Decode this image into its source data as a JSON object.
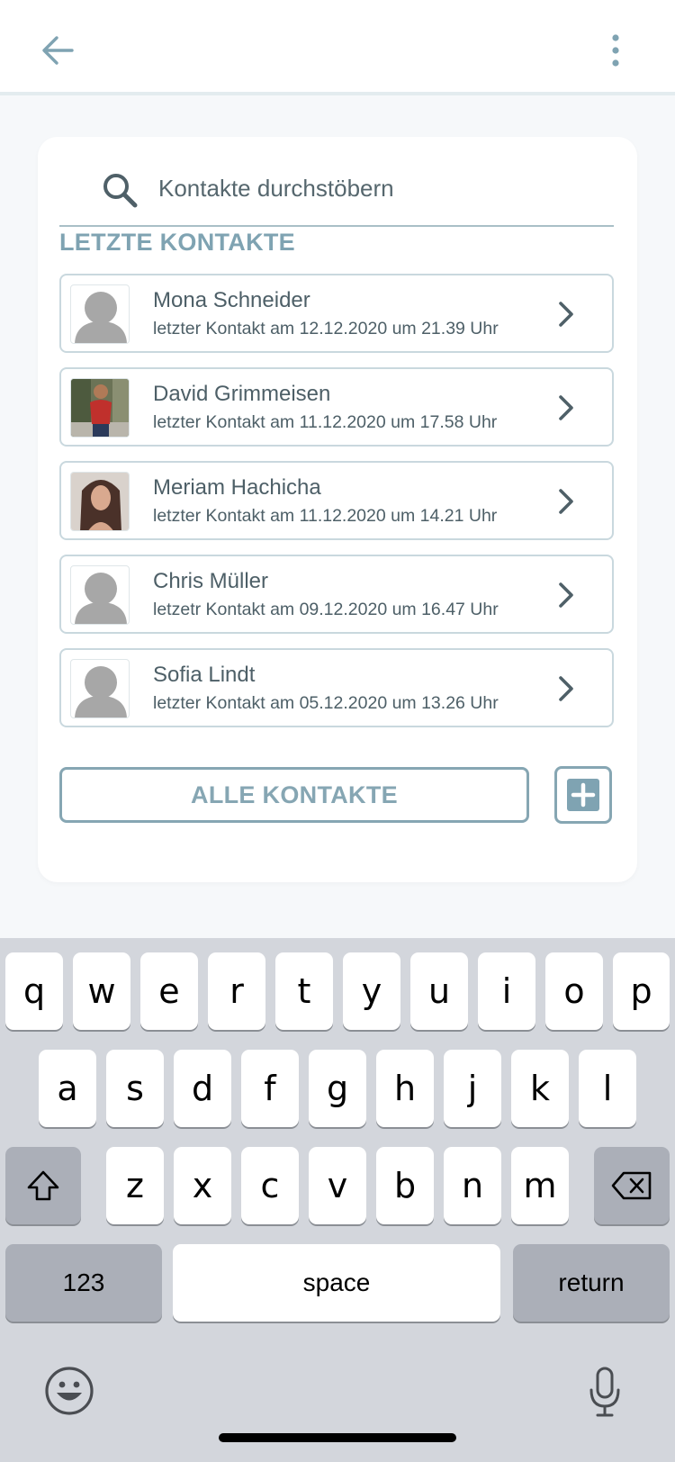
{
  "header": {
    "back_icon": "arrow-left-icon",
    "more_icon": "more-vertical-icon"
  },
  "search": {
    "placeholder": "Kontakte durchstöbern",
    "icon": "search-icon"
  },
  "section_title": "LETZTE KONTAKTE",
  "contacts": [
    {
      "name": "Mona Schneider",
      "last_contact": "letzter Kontakt am 12.12.2020 um 21.39 Uhr",
      "avatar": "placeholder"
    },
    {
      "name": "David Grimmeisen",
      "last_contact": "letzter Kontakt am 11.12.2020 um 17.58 Uhr",
      "avatar": "photo"
    },
    {
      "name": "Meriam Hachicha",
      "last_contact": "letzter Kontakt am 11.12.2020 um 14.21 Uhr",
      "avatar": "photo"
    },
    {
      "name": "Chris Müller",
      "last_contact": "letzetr Kontakt am 09.12.2020 um 16.47 Uhr",
      "avatar": "placeholder"
    },
    {
      "name": "Sofia Lindt",
      "last_contact": "letzter Kontakt am 05.12.2020 um 13.26 Uhr",
      "avatar": "placeholder"
    }
  ],
  "buttons": {
    "all_contacts": "ALLE KONTAKTE",
    "add_icon": "plus-square-icon"
  },
  "keyboard": {
    "row1": [
      "q",
      "w",
      "e",
      "r",
      "t",
      "y",
      "u",
      "i",
      "o",
      "p"
    ],
    "row2": [
      "a",
      "s",
      "d",
      "f",
      "g",
      "h",
      "j",
      "k",
      "l"
    ],
    "row3": [
      "z",
      "x",
      "c",
      "v",
      "b",
      "n",
      "m"
    ],
    "numbers_label": "123",
    "space_label": "space",
    "return_label": "return",
    "shift_icon": "shift-icon",
    "delete_icon": "delete-backspace-icon",
    "emoji_icon": "emoji-icon",
    "mic_icon": "microphone-icon"
  },
  "colors": {
    "accent": "#7fa3b2",
    "text": "#4e6068",
    "border": "#c9d8de",
    "keyboard_bg": "#d3d6dc"
  }
}
